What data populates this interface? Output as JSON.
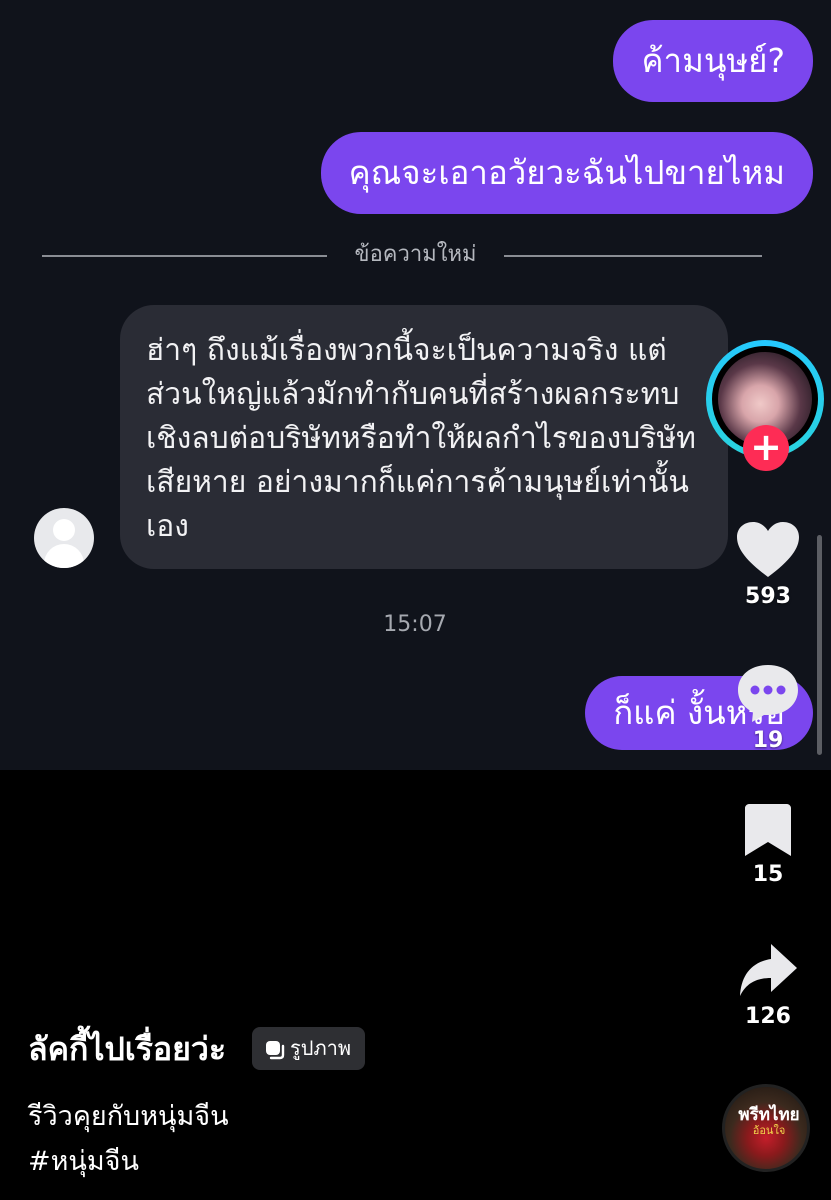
{
  "chat": {
    "out_message_1": "ค้ามนุษย์?",
    "out_message_2": "คุณจะเอาอวัยวะฉันไปขายไหม",
    "divider_label": "ข้อความใหม่",
    "in_message": "ฮ่าๆ ถึงแม้เรื่องพวกนี้จะเป็นความจริง แต่ส่วนใหญ่แล้วมักทำกับคนที่สร้างผลกระทบเชิงลบต่อบริษัทหรือทำให้ผลกำไรของบริษัทเสียหาย อย่างมากก็แค่การค้ามนุษย์เท่านั้นเอง",
    "timestamp": "15:07",
    "out_message_3": "ก็แค่ งั้นหรอ"
  },
  "actions": {
    "follow_symbol": "+",
    "likes": "593",
    "comments": "19",
    "saves": "15",
    "shares": "126"
  },
  "caption": {
    "username": "ลัคกี้ไปเรื่อยว่ะ",
    "badge_label": "รูปภาพ",
    "line1": "รีวิวคุยกับหนุ่มจีน",
    "hashtag": "#หนุ่มจีน"
  },
  "music": {
    "disc_logo": "พรีทไทย",
    "disc_sub": "อ้อนใจ"
  },
  "colors": {
    "outgoing_bubble": "#7b46ee",
    "incoming_bubble": "#2a2c35",
    "chat_background": "#10131b",
    "follow_button": "#fe2c55",
    "story_ring": "#25c8ff"
  },
  "icons": [
    "heart-icon",
    "comment-dots-icon",
    "bookmark-icon",
    "share-arrow-icon",
    "photo-stack-icon",
    "plus-icon",
    "default-avatar-icon"
  ]
}
